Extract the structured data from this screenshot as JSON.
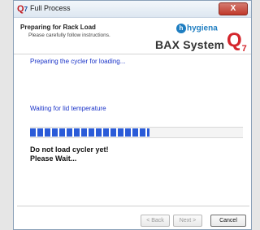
{
  "window": {
    "title": "Full Process",
    "close_label": "X",
    "app_icon": "Q"
  },
  "header": {
    "title": "Preparing for Rack Load",
    "subtitle": "Please carefully follow instructions.",
    "logo": {
      "brand": "hygiena",
      "product": "BAX System",
      "q_mark": "Q",
      "q_number": "7"
    }
  },
  "status": {
    "message1": "Preparing the cycler for loading...",
    "message2": "Waiting for lid temperature",
    "progress_fraction": 0.56,
    "warning_line1": "Do not load cycler yet!",
    "warning_line2": "Please Wait..."
  },
  "buttons": {
    "back": "< Back",
    "next": "Next >",
    "cancel": "Cancel"
  },
  "colors": {
    "accent_blue": "#1a33c8",
    "progress": "#2a5bd8",
    "brand_red": "#d4262c"
  }
}
